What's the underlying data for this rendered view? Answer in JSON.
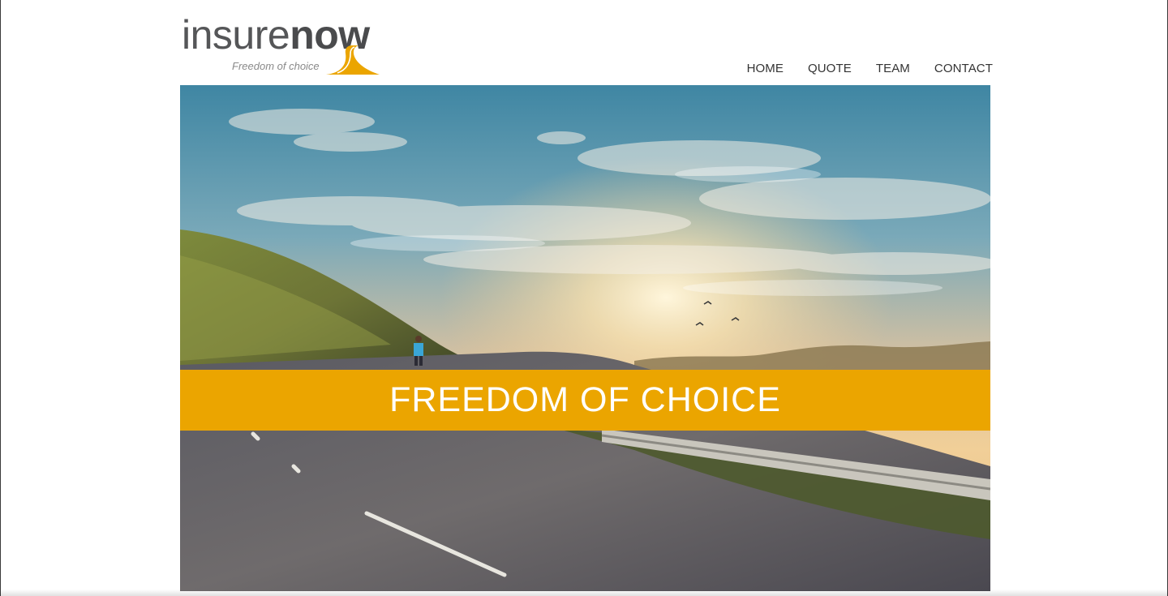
{
  "logo": {
    "word_light": "insure",
    "word_bold": "now",
    "tagline": "Freedom of choice",
    "accent_color": "#eba500"
  },
  "nav": {
    "items": [
      {
        "label": "HOME"
      },
      {
        "label": "QUOTE"
      },
      {
        "label": "TEAM"
      },
      {
        "label": "CONTACT"
      }
    ]
  },
  "hero": {
    "image_icon": "sunset-road-photo",
    "banner_text": "FREEDOM OF CHOICE",
    "banner_color": "#eba500"
  }
}
